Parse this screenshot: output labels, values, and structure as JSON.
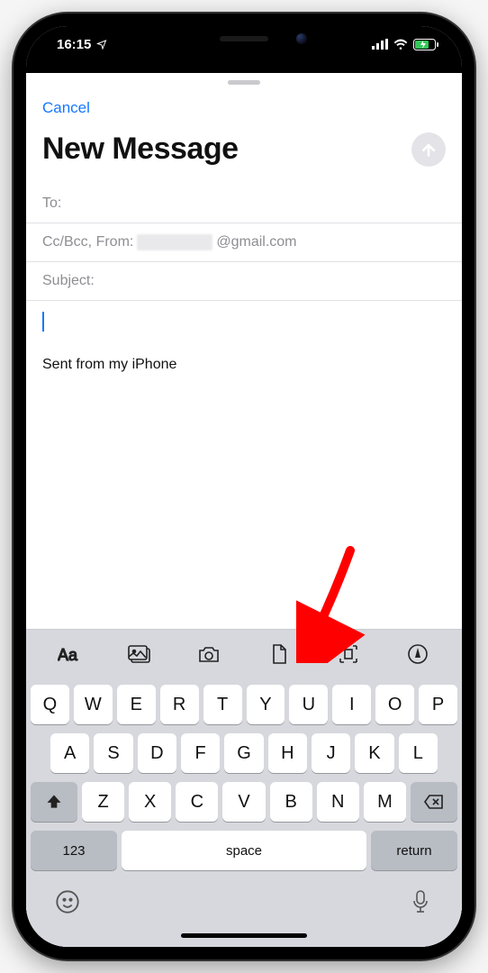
{
  "status": {
    "time": "16:15"
  },
  "app": {
    "cancel_label": "Cancel",
    "title": "New Message",
    "fields": {
      "to_label": "To:",
      "ccbcc_from_label": "Cc/Bcc, From:",
      "email_domain": "@gmail.com",
      "subject_label": "Subject:"
    },
    "signature": "Sent from my iPhone"
  },
  "toolbar": {
    "items": [
      "format-text-icon",
      "photo-library-icon",
      "camera-icon",
      "attach-document-icon",
      "scan-document-icon",
      "markup-icon"
    ]
  },
  "keyboard": {
    "row1": [
      "Q",
      "W",
      "E",
      "R",
      "T",
      "Y",
      "U",
      "I",
      "O",
      "P"
    ],
    "row2": [
      "A",
      "S",
      "D",
      "F",
      "G",
      "H",
      "J",
      "K",
      "L"
    ],
    "row3": [
      "Z",
      "X",
      "C",
      "V",
      "B",
      "N",
      "M"
    ],
    "number_key": "123",
    "space_label": "space",
    "return_label": "return"
  }
}
